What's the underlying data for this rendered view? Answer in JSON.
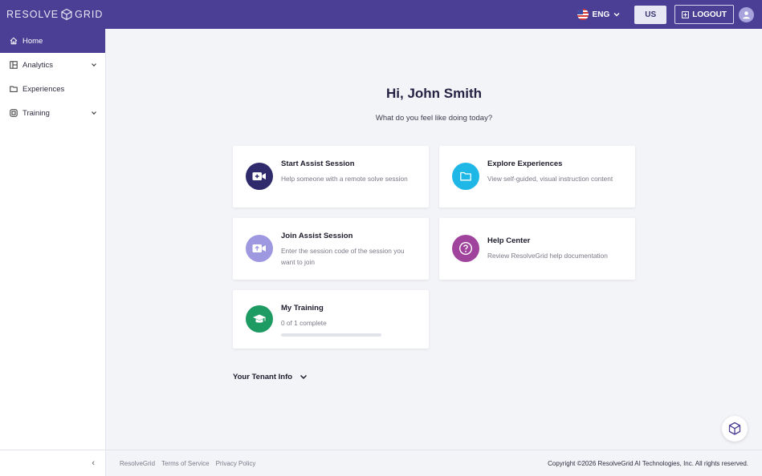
{
  "header": {
    "brand_left": "RESOLVE",
    "brand_right": "GRID",
    "language": "ENG",
    "region": "US",
    "logout_label": "LOGOUT"
  },
  "sidebar": {
    "items": [
      {
        "label": "Home",
        "icon": "home-icon",
        "active": true
      },
      {
        "label": "Analytics",
        "icon": "analytics-icon",
        "expandable": true
      },
      {
        "label": "Experiences",
        "icon": "folder-icon"
      },
      {
        "label": "Training",
        "icon": "training-icon",
        "expandable": true
      }
    ],
    "collapse_glyph": "‹"
  },
  "main": {
    "greeting": "Hi, John Smith",
    "subtitle": "What do you feel like doing today?",
    "cards": [
      {
        "title": "Start Assist Session",
        "desc": "Help someone with a remote solve session",
        "icon": "video-plus-icon",
        "color": "#2f2a6b"
      },
      {
        "title": "Explore Experiences",
        "desc": "View self-guided, visual instruction content",
        "icon": "folder-icon",
        "color": "#1fb8e6"
      },
      {
        "title": "Join Assist Session",
        "desc": "Enter the session code of the session you want to join",
        "icon": "video-join-icon",
        "color": "#9d98e0"
      },
      {
        "title": "Help Center",
        "desc": "Review ResolveGrid help documentation",
        "icon": "question-icon",
        "color": "#a0439c"
      },
      {
        "title": "My Training",
        "desc": "0 of 1 complete",
        "icon": "graduation-cap-icon",
        "color": "#1e9a63",
        "progress": 0
      }
    ],
    "tenant_label": "Your Tenant Info"
  },
  "footer": {
    "links": [
      "ResolveGrid",
      "Terms of Service",
      "Privacy Policy"
    ],
    "copyright": "Copyright ©2026 ResolveGrid AI Technologies, Inc. All rights reserved."
  },
  "colors": {
    "brand": "#4a3f94",
    "background": "#f3f4f8"
  }
}
